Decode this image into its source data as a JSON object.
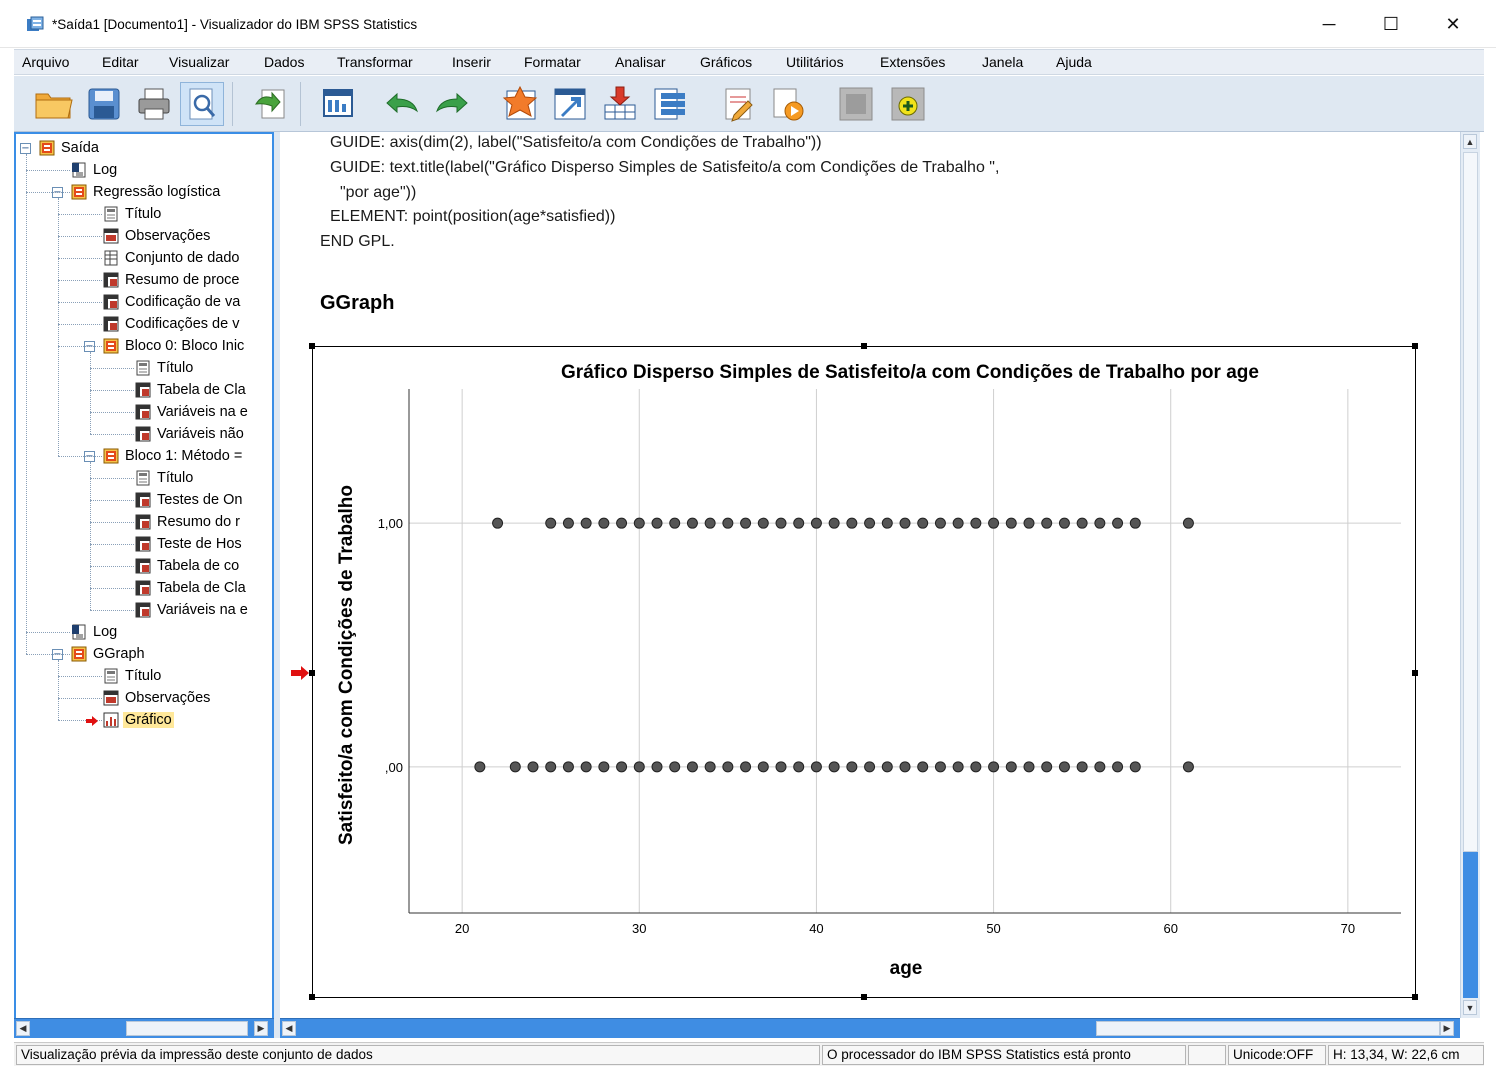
{
  "window": {
    "title": "*Saída1 [Documento1] - Visualizador do IBM SPSS Statistics",
    "minimize": "─",
    "maximize": "☐",
    "close": "✕"
  },
  "menu": [
    "Arquivo",
    "Editar",
    "Visualizar",
    "Dados",
    "Transformar",
    "Inserir",
    "Formatar",
    "Analisar",
    "Gráficos",
    "Utilitários",
    "Extensões",
    "Janela",
    "Ajuda"
  ],
  "toolbar": {
    "icons": [
      "open-folder-icon",
      "save-icon",
      "print-icon",
      "print-preview-icon",
      "export-icon",
      "goto-data-icon",
      "undo-icon",
      "redo-icon",
      "designated-window-icon",
      "goto-case-icon",
      "insert-variable-icon",
      "value-labels-icon",
      "script-icon",
      "run-icon",
      "disabled-icon",
      "add-icon"
    ]
  },
  "tree": {
    "nodes": [
      {
        "label": "Saída",
        "level": 0,
        "icon": "output-book-icon",
        "toggle": "−"
      },
      {
        "label": "Log",
        "level": 1,
        "icon": "log-icon"
      },
      {
        "label": "Regressão logística",
        "level": 1,
        "icon": "output-book-icon",
        "toggle": "−"
      },
      {
        "label": "Título",
        "level": 2,
        "icon": "title-icon"
      },
      {
        "label": "Observações",
        "level": 2,
        "icon": "notes-icon"
      },
      {
        "label": "Conjunto de dado",
        "level": 2,
        "icon": "table-icon"
      },
      {
        "label": "Resumo de proce",
        "level": 2,
        "icon": "pivot-table-icon"
      },
      {
        "label": "Codificação de va",
        "level": 2,
        "icon": "pivot-table-icon"
      },
      {
        "label": "Codificações de v",
        "level": 2,
        "icon": "pivot-table-icon"
      },
      {
        "label": "Bloco 0: Bloco Inic",
        "level": 2,
        "icon": "output-book-icon",
        "toggle": "−"
      },
      {
        "label": "Título",
        "level": 3,
        "icon": "title-icon"
      },
      {
        "label": "Tabela de Cla",
        "level": 3,
        "icon": "pivot-table-icon"
      },
      {
        "label": "Variáveis na e",
        "level": 3,
        "icon": "pivot-table-icon"
      },
      {
        "label": "Variáveis não",
        "level": 3,
        "icon": "pivot-table-icon"
      },
      {
        "label": "Bloco 1: Método =",
        "level": 2,
        "icon": "output-book-icon",
        "toggle": "−"
      },
      {
        "label": "Título",
        "level": 3,
        "icon": "title-icon"
      },
      {
        "label": "Testes de On",
        "level": 3,
        "icon": "pivot-table-icon"
      },
      {
        "label": "Resumo do r",
        "level": 3,
        "icon": "pivot-table-icon"
      },
      {
        "label": "Teste de Hos",
        "level": 3,
        "icon": "pivot-table-icon"
      },
      {
        "label": "Tabela de co",
        "level": 3,
        "icon": "pivot-table-icon"
      },
      {
        "label": "Tabela de Cla",
        "level": 3,
        "icon": "pivot-table-icon"
      },
      {
        "label": "Variáveis na e",
        "level": 3,
        "icon": "pivot-table-icon"
      },
      {
        "label": "Log",
        "level": 1,
        "icon": "log-icon"
      },
      {
        "label": "GGraph",
        "level": 1,
        "icon": "output-book-icon",
        "toggle": "−"
      },
      {
        "label": "Título",
        "level": 2,
        "icon": "title-icon"
      },
      {
        "label": "Observações",
        "level": 2,
        "icon": "notes-icon"
      },
      {
        "label": "Gráfico",
        "level": 2,
        "icon": "chart-icon",
        "selected": true
      }
    ]
  },
  "content": {
    "code_lines": [
      "GUIDE: axis(dim(2), label(\"Satisfeito/a com Condições de Trabalho\"))",
      "GUIDE: text.title(label(\"Gráfico Disperso Simples de Satisfeito/a com Condições de Trabalho \",",
      "\"por age\"))",
      "ELEMENT: point(position(age*satisfied))",
      "END GPL."
    ],
    "heading": "GGraph"
  },
  "chart_data": {
    "type": "scatter",
    "title": "Gráfico Disperso Simples de Satisfeito/a com Condições de Trabalho por age",
    "xlabel": "age",
    "ylabel": "Satisfeito/a com Condições de Trabalho",
    "xlim": [
      17,
      73
    ],
    "ylim": [
      -0.6,
      1.6
    ],
    "x_ticks": [
      20,
      30,
      40,
      50,
      60,
      70
    ],
    "y_ticks": [
      0,
      1
    ],
    "y_tick_labels": [
      ",00",
      "1,00"
    ],
    "grid": true,
    "series": [
      {
        "x": [
          21,
          23,
          24,
          25,
          26,
          27,
          28,
          29,
          30,
          31,
          32,
          33,
          34,
          35,
          36,
          37,
          38,
          39,
          40,
          41,
          42,
          43,
          44,
          45,
          46,
          47,
          48,
          49,
          50,
          51,
          52,
          53,
          54,
          55,
          56,
          57,
          58,
          61
        ],
        "y": 0
      },
      {
        "x": [
          22,
          25,
          26,
          27,
          28,
          29,
          30,
          31,
          32,
          33,
          34,
          35,
          36,
          37,
          38,
          39,
          40,
          41,
          42,
          43,
          44,
          45,
          46,
          47,
          48,
          49,
          50,
          51,
          52,
          53,
          54,
          55,
          56,
          57,
          58,
          61
        ],
        "y": 1
      }
    ],
    "point_color": "#555555"
  },
  "status": {
    "left": "Visualização prévia da impressão deste conjunto de dados",
    "processor": "O processador do IBM SPSS Statistics  está pronto",
    "unicode": "Unicode:OFF",
    "size": "H: 13,34, W: 22,6 cm"
  }
}
